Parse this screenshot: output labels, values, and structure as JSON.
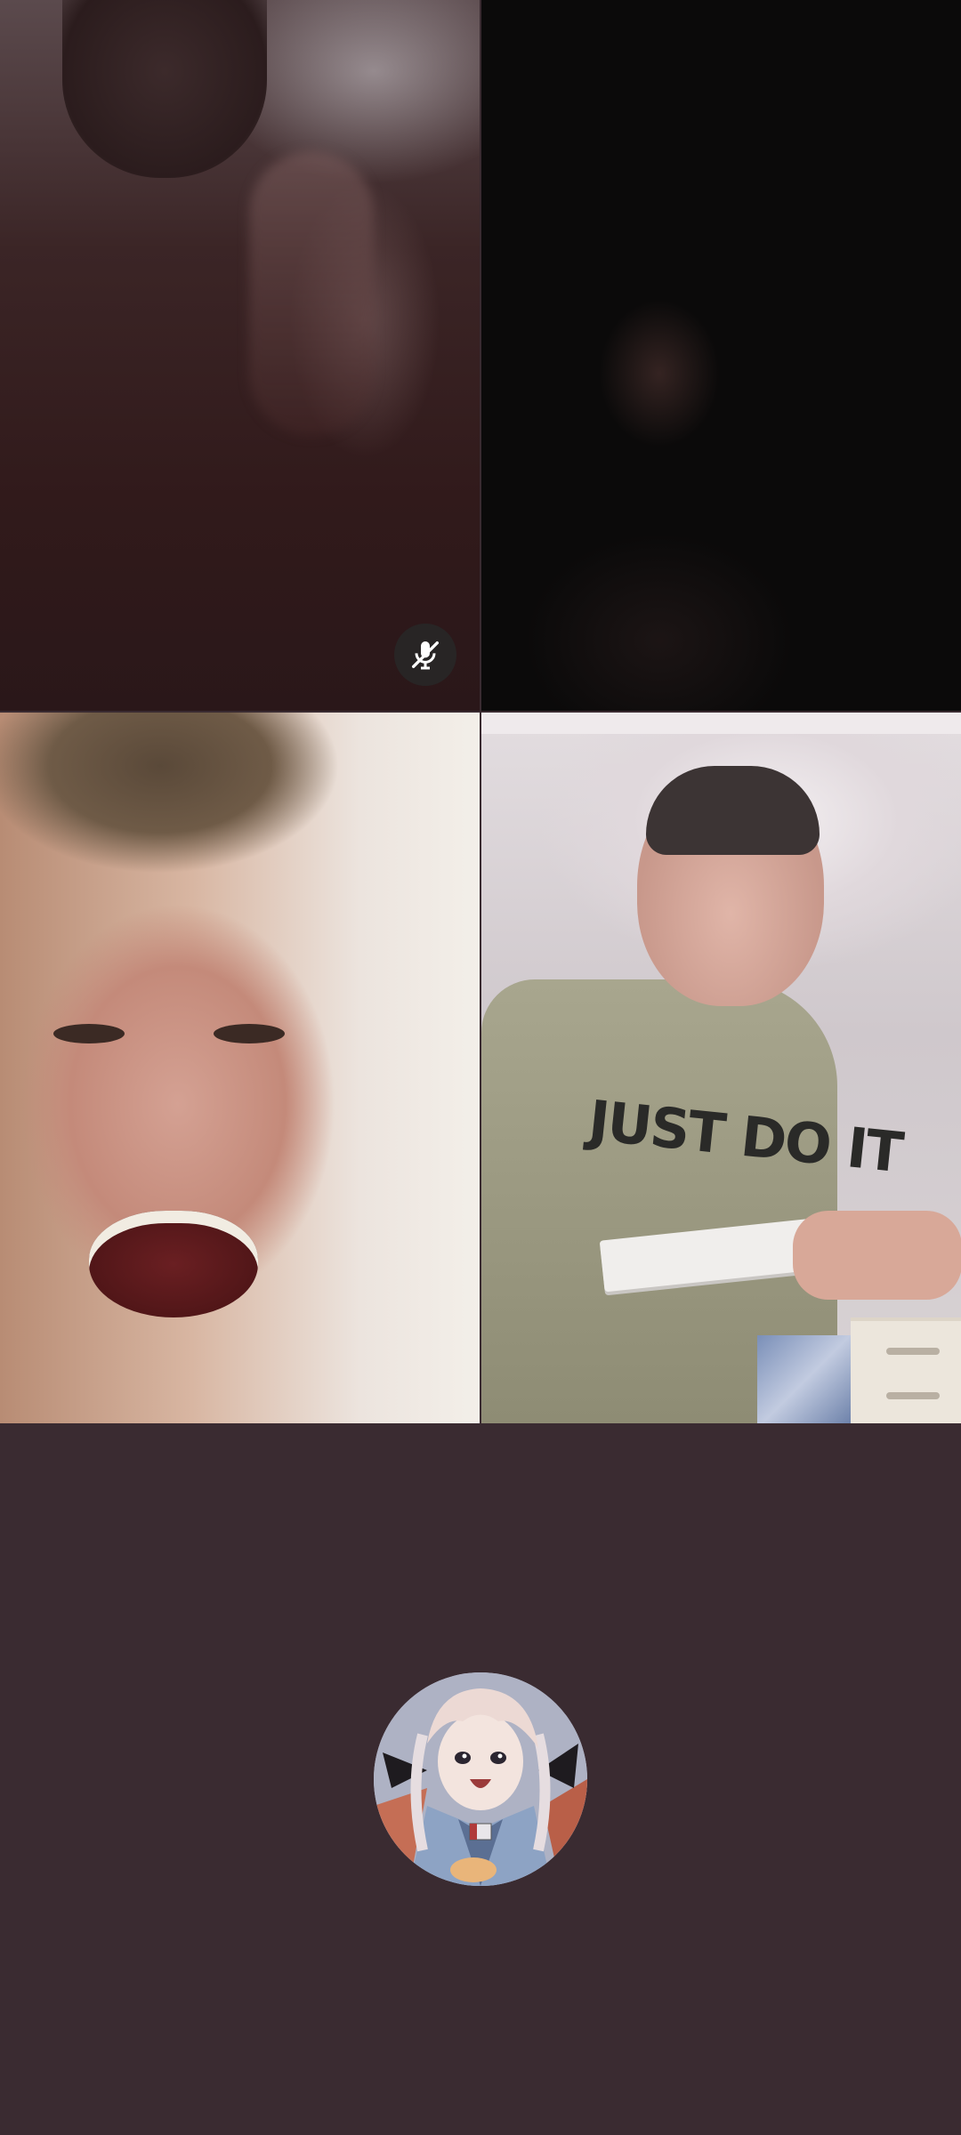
{
  "call": {
    "participants": [
      {
        "tile": "participant-1",
        "muted": true,
        "mute_icon": "mic-off-icon"
      },
      {
        "tile": "participant-2",
        "muted": false
      },
      {
        "tile": "participant-3",
        "muted": false
      },
      {
        "tile": "participant-4",
        "muted": false
      }
    ],
    "self_view": {
      "camera_on": false,
      "avatar_icon": "anime-avatar-icon"
    }
  },
  "shirt_print": "JUST DO IT",
  "colors": {
    "background": "#3a2b31",
    "mute_badge": "#282828"
  }
}
